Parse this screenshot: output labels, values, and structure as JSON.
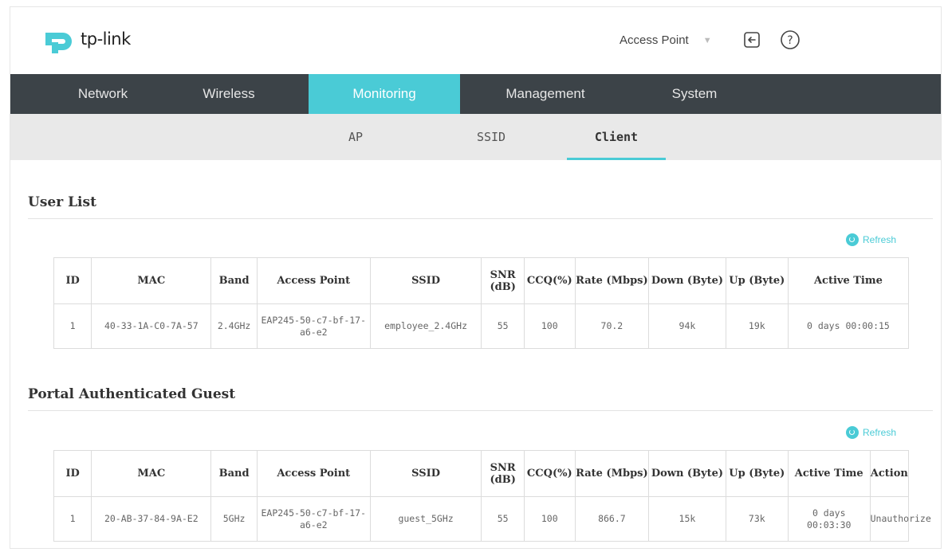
{
  "header": {
    "logo_text": "tp-link",
    "mode": "Access Point",
    "logout_icon": "logout-icon",
    "help_icon": "help-icon",
    "brand_color": "#4acbd6"
  },
  "main_nav": [
    {
      "label": "Network"
    },
    {
      "label": "Wireless"
    },
    {
      "label": "Monitoring"
    },
    {
      "label": "Management"
    },
    {
      "label": "System"
    }
  ],
  "active_main_nav": "Monitoring",
  "sub_nav": [
    {
      "label": "AP"
    },
    {
      "label": "SSID"
    },
    {
      "label": "Client"
    }
  ],
  "active_sub_nav": "Client",
  "user_list": {
    "title": "User List",
    "refresh_label": "Refresh",
    "columns": [
      "ID",
      "MAC",
      "Band",
      "Access Point",
      "SSID",
      "SNR (dB)",
      "CCQ(%)",
      "Rate (Mbps)",
      "Down (Byte)",
      "Up (Byte)",
      "Active Time"
    ],
    "rows": [
      [
        "1",
        "40-33-1A-C0-7A-57",
        "2.4GHz",
        "EAP245-50-c7-bf-17-a6-e2",
        "employee_2.4GHz",
        "55",
        "100",
        "70.2",
        "94k",
        "19k",
        "0 days 00:00:15"
      ]
    ]
  },
  "portal_guest": {
    "title": "Portal Authenticated Guest",
    "refresh_label": "Refresh",
    "columns": [
      "ID",
      "MAC",
      "Band",
      "Access Point",
      "SSID",
      "SNR (dB)",
      "CCQ(%)",
      "Rate (Mbps)",
      "Down (Byte)",
      "Up (Byte)",
      "Active Time",
      "Action"
    ],
    "rows": [
      [
        "1",
        "20-AB-37-84-9A-E2",
        "5GHz",
        "EAP245-50-c7-bf-17-a6-e2",
        "guest_5GHz",
        "55",
        "100",
        "866.7",
        "15k",
        "73k",
        "0 days 00:03:30",
        "Unauthorize"
      ]
    ]
  }
}
